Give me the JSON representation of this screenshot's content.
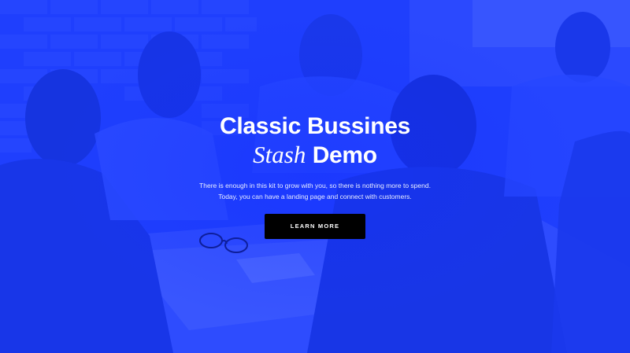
{
  "hero": {
    "title_line1": "Classic Bussines",
    "title_italic": "Stash",
    "title_bold": "Demo",
    "subtitle_line1": "There is enough in this kit to grow with you, so there is nothing more to spend.",
    "subtitle_line2": "Today, you can have a landing page and connect with customers.",
    "cta_label": "LEARN MORE"
  },
  "colors": {
    "accent": "#1e3fff",
    "button_bg": "#000000",
    "text": "#ffffff"
  }
}
